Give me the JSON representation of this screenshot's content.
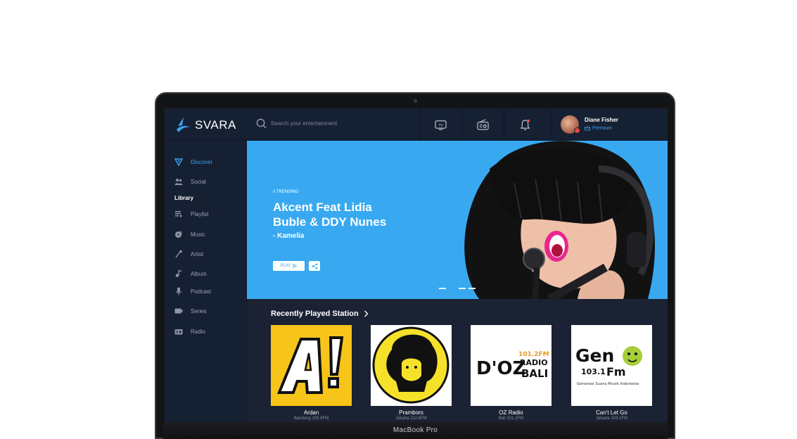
{
  "app": {
    "name": "SVARA",
    "device_label": "MacBook Pro"
  },
  "search": {
    "placeholder": "Search your entertainment"
  },
  "user": {
    "name": "Diane Fisher",
    "plan": "Premium"
  },
  "sidebar": {
    "items": [
      {
        "label": "Discover",
        "icon": "discover-icon",
        "active": true
      },
      {
        "label": "Social",
        "icon": "social-icon"
      }
    ],
    "library_title": "Library",
    "library_items": [
      {
        "label": "Playlist",
        "icon": "playlist-icon"
      },
      {
        "label": "Music",
        "icon": "music-icon"
      },
      {
        "label": "Artist",
        "icon": "artist-icon"
      },
      {
        "label": "Album",
        "icon": "album-icon"
      },
      {
        "label": "Podcast",
        "icon": "podcast-icon"
      },
      {
        "label": "Series",
        "icon": "series-icon"
      },
      {
        "label": "Radio",
        "icon": "radio-icon"
      }
    ]
  },
  "hero": {
    "tag": "// TRENDING",
    "title_line1": "Akcent Feat Lidia",
    "title_line2": "Buble & DDY Nunes",
    "subtitle": "- Kamelia",
    "play_label": "PLAY"
  },
  "recently_played": {
    "title": "Recently Played Station",
    "stations": [
      {
        "name": "Ardan",
        "freq": "Bandung 105.9FM"
      },
      {
        "name": "Prambors",
        "freq": "Jakarta 112.6FM"
      },
      {
        "name": "OZ Radio",
        "freq": "Bali 101.2FM"
      },
      {
        "name": "Can't Let Go",
        "freq": "Jakarta 103.1FM"
      }
    ]
  },
  "colors": {
    "accent": "#38a9f0",
    "background": "#1b2233",
    "sidebar": "#162033"
  }
}
